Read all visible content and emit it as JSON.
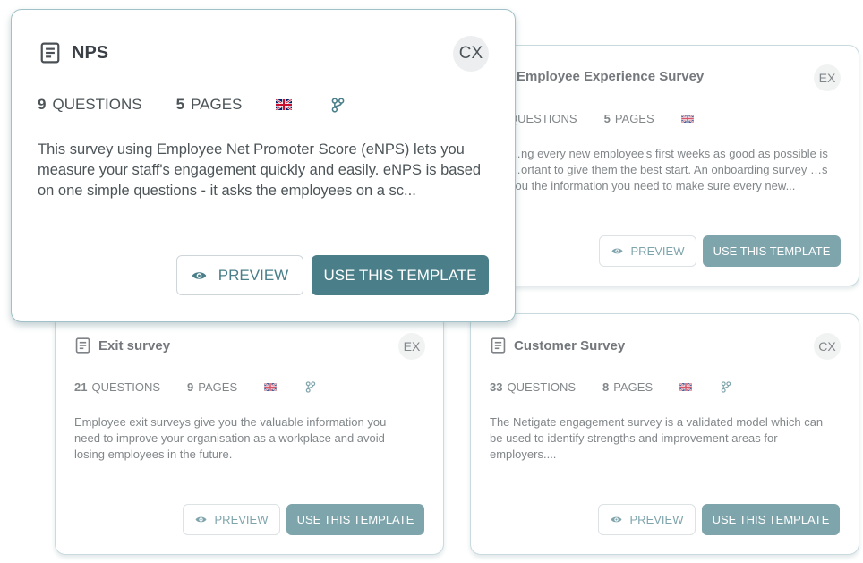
{
  "colors": {
    "accent": "#4a7f89",
    "card_border": "#b3cdd2",
    "badge_bg": "#eceeef"
  },
  "cards": [
    {
      "title": "Employee Experience Survey",
      "badge": "EX",
      "questions_count": "",
      "questions_label": "QUESTIONS",
      "pages_count": "5",
      "pages_label": "PAGES",
      "flag_icon": "uk-flag-icon",
      "description": "…ng every new employee's first weeks as good as possible is …ortant to give them the best start. An onboarding survey …s you the information you need to make sure every new...",
      "preview_label": "PREVIEW",
      "use_label": "USE THIS TEMPLATE"
    },
    {
      "title": "Exit survey",
      "badge": "EX",
      "questions_count": "21",
      "questions_label": "QUESTIONS",
      "pages_count": "9",
      "pages_label": "PAGES",
      "flag_icon": "uk-flag-icon",
      "description": "Employee exit surveys give you the valuable information you need to improve your organisation as a workplace and avoid losing employees in the future.",
      "preview_label": "PREVIEW",
      "use_label": "USE THIS TEMPLATE"
    },
    {
      "title": "Customer Survey",
      "badge": "CX",
      "questions_count": "33",
      "questions_label": "QUESTIONS",
      "pages_count": "8",
      "pages_label": "PAGES",
      "flag_icon": "uk-flag-icon",
      "description": "The Netigate engagement survey is a validated model which can be used to identify strengths and improvement areas for employers....",
      "preview_label": "PREVIEW",
      "use_label": "USE THIS TEMPLATE"
    },
    {
      "title": "NPS",
      "badge": "CX",
      "questions_count": "9",
      "questions_label": "QUESTIONS",
      "pages_count": "5",
      "pages_label": "PAGES",
      "flag_icon": "uk-flag-icon",
      "description": "This survey using Employee Net Promoter Score (eNPS) lets you measure your staff's engagement quickly and easily. eNPS is based on one simple questions - it asks the employees on a sc...",
      "preview_label": "PREVIEW",
      "use_label": "USE THIS TEMPLATE"
    }
  ]
}
